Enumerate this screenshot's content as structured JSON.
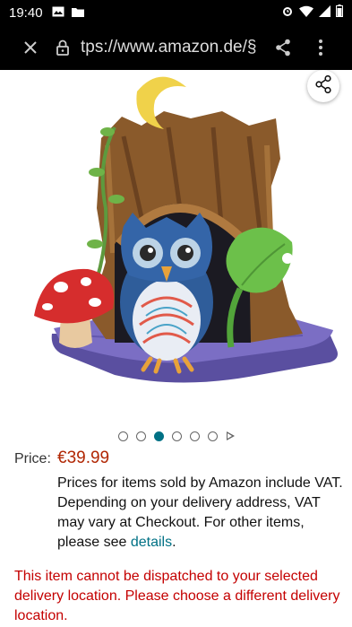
{
  "status_bar": {
    "time": "19:40",
    "left_icons": [
      "gallery-icon",
      "folder-icon"
    ],
    "right_icons": [
      "alarm-icon",
      "wifi-icon",
      "signal-icon",
      "battery-icon"
    ]
  },
  "browser": {
    "url": "tps://www.amazon.de/§",
    "icons": [
      "close-icon",
      "lock-icon",
      "share-icon",
      "more-vert-icon"
    ]
  },
  "product": {
    "image_alt": "Owl toy in tree stump with mushroom and moon",
    "share_icon": "share-icon",
    "carousel": {
      "total": 6,
      "active_index": 2,
      "next_icon": "play-triangle-icon"
    }
  },
  "price": {
    "label": "Price:",
    "value": "€39.99"
  },
  "vat": {
    "text": "Prices for items sold by Amazon include VAT. Depending on your delivery address, VAT may vary at Checkout. For other items, please see ",
    "link": "details",
    "suffix": "."
  },
  "warning": {
    "text": "This item cannot be dispatched to your selected delivery location. Please choose a different delivery location."
  },
  "colors": {
    "price": "#b12704",
    "link": "#007185",
    "warning": "#c40000",
    "active_dot": "#007185"
  }
}
